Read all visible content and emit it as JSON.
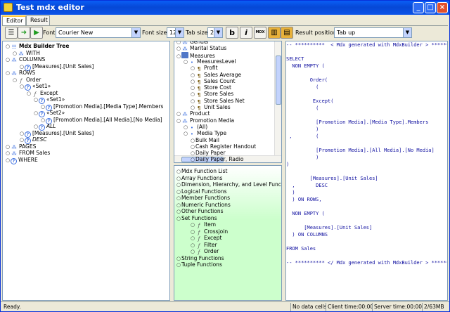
{
  "window": {
    "title": "Test mdx editor"
  },
  "tabs": [
    {
      "label": "Editor"
    },
    {
      "label": "Result"
    }
  ],
  "toolbar": {
    "font_label": "Font:",
    "font_value": "Courier New",
    "font_size_label": "Font size:",
    "font_size_value": "12",
    "tab_size_label": "Tab size:",
    "tab_size_value": "2",
    "bold_glyph": "b",
    "italic_glyph": "i",
    "mdx_glyph": "MDX",
    "result_position_label": "Result position:",
    "result_position_value": "Tab up"
  },
  "builder_tree": [
    {
      "label": "Mdx Builder Tree",
      "icon": "tree-root-icon",
      "indent": 0,
      "bold": true
    },
    {
      "label": "WITH",
      "icon": "dimension-icon",
      "indent": 1
    },
    {
      "label": "COLUMNS",
      "icon": "dimension-icon",
      "indent": 0
    },
    {
      "label": "[Measures].[Unit Sales]",
      "icon": "help-icon",
      "indent": 2
    },
    {
      "label": "ROWS",
      "icon": "dimension-icon",
      "indent": 0
    },
    {
      "label": "Order",
      "icon": "function-icon",
      "indent": 1
    },
    {
      "label": "«Set1»",
      "icon": "help-icon",
      "indent": 2
    },
    {
      "label": "Except",
      "icon": "function-icon",
      "indent": 3
    },
    {
      "label": "«Set1»",
      "icon": "help-icon",
      "indent": 4
    },
    {
      "label": "[Promotion Media].[Media Type].Members",
      "icon": "help-icon",
      "indent": 5
    },
    {
      "label": "«Set2»",
      "icon": "help-icon",
      "indent": 4
    },
    {
      "label": "[Promotion Media].[All Media].[No Media]",
      "icon": "help-icon",
      "indent": 5
    },
    {
      "label": "ALL",
      "icon": "help-icon",
      "indent": 4,
      "italic": true
    },
    {
      "label": "[Measures].[Unit Sales]",
      "icon": "help-icon",
      "indent": 2
    },
    {
      "label": "DESC",
      "icon": "help-icon",
      "indent": 2,
      "italic": true
    },
    {
      "label": "PAGES",
      "icon": "dimension-icon",
      "indent": 0
    },
    {
      "label": "FROM Sales",
      "icon": "dimension-icon",
      "indent": 0
    },
    {
      "label": "WHERE",
      "icon": "help-icon",
      "indent": 0
    }
  ],
  "cube_tree": [
    {
      "label": "Gender",
      "icon": "dimension-icon",
      "indent": 0
    },
    {
      "label": "Marital Status",
      "icon": "dimension-icon",
      "indent": 0
    },
    {
      "label": "Measures",
      "icon": "folder-icon",
      "indent": 0
    },
    {
      "label": "MeasuresLevel",
      "icon": "level-icon",
      "indent": 1
    },
    {
      "label": "Profit",
      "icon": "measure-icon",
      "indent": 2
    },
    {
      "label": "Sales Average",
      "icon": "measure-icon",
      "indent": 2
    },
    {
      "label": "Sales Count",
      "icon": "measure-icon",
      "indent": 2
    },
    {
      "label": "Store Cost",
      "icon": "measure-icon",
      "indent": 2
    },
    {
      "label": "Store Sales",
      "icon": "measure-icon",
      "indent": 2
    },
    {
      "label": "Store Sales Net",
      "icon": "measure-icon",
      "indent": 2
    },
    {
      "label": "Unit Sales",
      "icon": "measure-icon",
      "indent": 2
    },
    {
      "label": "Product",
      "icon": "dimension-icon",
      "indent": 0
    },
    {
      "label": "Promotion Media",
      "icon": "dimension-icon",
      "indent": 0
    },
    {
      "label": "(All)",
      "icon": "level-icon",
      "indent": 1
    },
    {
      "label": "Media Type",
      "icon": "level-icon",
      "indent": 1
    },
    {
      "label": "Bulk Mail",
      "icon": "none",
      "indent": 2
    },
    {
      "label": "Cash Register Handout",
      "icon": "none",
      "indent": 2
    },
    {
      "label": "Daily Paper",
      "icon": "none",
      "indent": 2
    },
    {
      "label": "Daily Paper, Radio",
      "icon": "none",
      "indent": 2
    }
  ],
  "function_tree": [
    {
      "label": "Mdx Function List",
      "icon": "none",
      "indent": 0
    },
    {
      "label": "Array Functions",
      "icon": "none",
      "indent": 0
    },
    {
      "label": "Dimension, Hierarchy, and Level Functions",
      "icon": "none",
      "indent": 0
    },
    {
      "label": "Logical Functions",
      "icon": "none",
      "indent": 0
    },
    {
      "label": "Member Functions",
      "icon": "none",
      "indent": 0
    },
    {
      "label": "Numeric Functions",
      "icon": "none",
      "indent": 0
    },
    {
      "label": "Other Functions",
      "icon": "none",
      "indent": 0
    },
    {
      "label": "Set Functions",
      "icon": "none",
      "indent": 0
    },
    {
      "label": "Item",
      "icon": "function-icon",
      "indent": 2
    },
    {
      "label": "Crossjoin",
      "icon": "function-icon",
      "indent": 2
    },
    {
      "label": "Except",
      "icon": "function-icon",
      "indent": 2
    },
    {
      "label": "Filter",
      "icon": "function-icon",
      "indent": 2
    },
    {
      "label": "Order",
      "icon": "function-icon",
      "indent": 2
    },
    {
      "label": "String Functions",
      "icon": "none",
      "indent": 0
    },
    {
      "label": "Tuple Functions",
      "icon": "none",
      "indent": 0
    }
  ],
  "code_text": "-- **********  < Mdx generated with MdxBuilder > **********\n\nSELECT\n  NON EMPTY (\n\n        Order(\n          (\n\n         Except(\n          (\n\n          [Promotion Media].[Media Type].Members\n          )\n ,        (\n\n          [Promotion Media].[All Media].[No Media]\n          )\n)\n\n        [Measures].[Unit Sales]\n  ,       DESC\n  )\n  ) ON ROWS,\n\n  NON EMPTY (\n\n      [Measures].[Unit Sales]\n  ) ON COLUMNS\n\nFROM Sales\n\n-- ********** </ Mdx generated with MdxBuilder > **********",
  "status": {
    "ready": "Ready.",
    "data_cells": "No data cells.",
    "client_time": "Client time:00:00:00",
    "server_time": "Server time:00:00:00",
    "memory": "2/63MB"
  }
}
